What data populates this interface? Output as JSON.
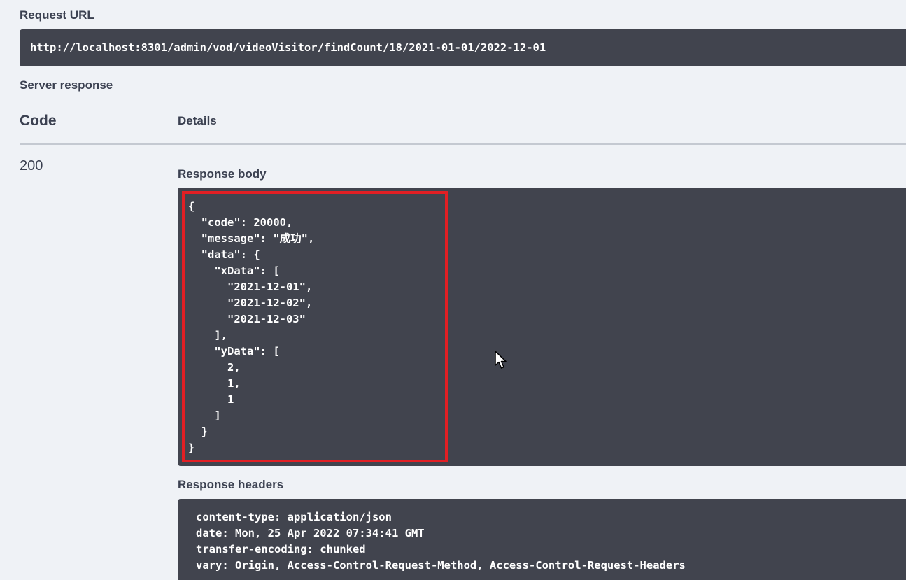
{
  "request_url": {
    "label": "Request URL",
    "value": "http://localhost:8301/admin/vod/videoVisitor/findCount/18/2021-01-01/2022-12-01"
  },
  "server_response": {
    "label": "Server response",
    "columns": {
      "code": "Code",
      "details": "Details"
    },
    "status_code": "200",
    "response_body": {
      "label": "Response body",
      "lines": [
        "{",
        "  \"code\": 20000,",
        "  \"message\": \"成功\",",
        "  \"data\": {",
        "    \"xData\": [",
        "      \"2021-12-01\",",
        "      \"2021-12-02\",",
        "      \"2021-12-03\"",
        "    ],",
        "    \"yData\": [",
        "      2,",
        "      1,",
        "      1",
        "    ]",
        "  }",
        "}"
      ]
    },
    "response_headers": {
      "label": "Response headers",
      "lines": [
        "content-type: application/json",
        "date: Mon, 25 Apr 2022 07:34:41 GMT",
        "transfer-encoding: chunked",
        "vary: Origin, Access-Control-Request-Method, Access-Control-Request-Headers"
      ]
    }
  },
  "colors": {
    "background": "#eff2f6",
    "code_block": "#41444e",
    "highlight": "#e21f24",
    "text": "#3b4151"
  },
  "icons": {
    "cursor": "mouse-pointer-icon"
  }
}
